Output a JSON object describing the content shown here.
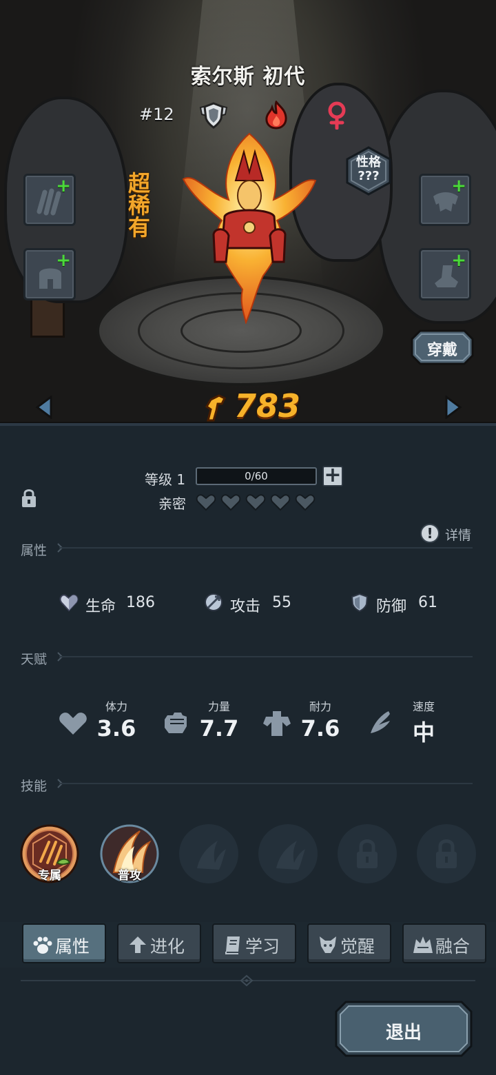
{
  "hero": {
    "name": "索尔斯 初代",
    "number": "#12",
    "rarity": "超稀有",
    "power": "783",
    "class_icon": "shield-wings-icon",
    "element_icon": "fire-icon",
    "gender_icon": "female-icon"
  },
  "personality": {
    "label": "性格",
    "value": "???"
  },
  "equipment": {
    "slots": [
      {
        "icon": "claw-icon"
      },
      {
        "icon": "helmet-icon"
      },
      {
        "icon": "armor-icon"
      },
      {
        "icon": "boots-icon"
      }
    ],
    "wear_label": "穿戴"
  },
  "level": {
    "label": "等级 1",
    "exp": "0/60",
    "exp_fraction": 0.0
  },
  "intimacy": {
    "label": "亲密",
    "hearts_filled": 0,
    "hearts_total": 5
  },
  "sections": {
    "attributes": "属性",
    "talent": "天赋",
    "skills": "技能"
  },
  "details_label": "详情",
  "stats": [
    {
      "name": "生命",
      "value": "186",
      "icon": "hp-heart-icon"
    },
    {
      "name": "攻击",
      "value": "55",
      "icon": "attack-icon"
    },
    {
      "name": "防御",
      "value": "61",
      "icon": "defense-icon"
    }
  ],
  "talents": [
    {
      "label": "体力",
      "value": "3.6",
      "icon": "stamina-heart-icon"
    },
    {
      "label": "力量",
      "value": "7.7",
      "icon": "fist-icon"
    },
    {
      "label": "耐力",
      "value": "7.6",
      "icon": "muscle-icon"
    },
    {
      "label": "速度",
      "value": "中",
      "icon": "wing-icon"
    }
  ],
  "skills": [
    {
      "label": "专属",
      "state": "exclusive"
    },
    {
      "label": "普攻",
      "state": "basic"
    },
    {
      "label": "",
      "state": "empty"
    },
    {
      "label": "",
      "state": "empty"
    },
    {
      "label": "",
      "state": "locked"
    },
    {
      "label": "",
      "state": "locked"
    }
  ],
  "tabs": [
    {
      "label": "属性",
      "icon": "paw-icon",
      "active": true
    },
    {
      "label": "进化",
      "icon": "evolve-arrow-icon",
      "active": false
    },
    {
      "label": "学习",
      "icon": "book-icon",
      "active": false
    },
    {
      "label": "觉醒",
      "icon": "beast-head-icon",
      "active": false
    },
    {
      "label": "融合",
      "icon": "fusion-icon",
      "active": false
    }
  ],
  "exit_label": "退出",
  "colors": {
    "rarity": "#f3a62a",
    "power": "#f6b22a",
    "plus": "#4bd93a",
    "active_tab": "#56707e"
  }
}
